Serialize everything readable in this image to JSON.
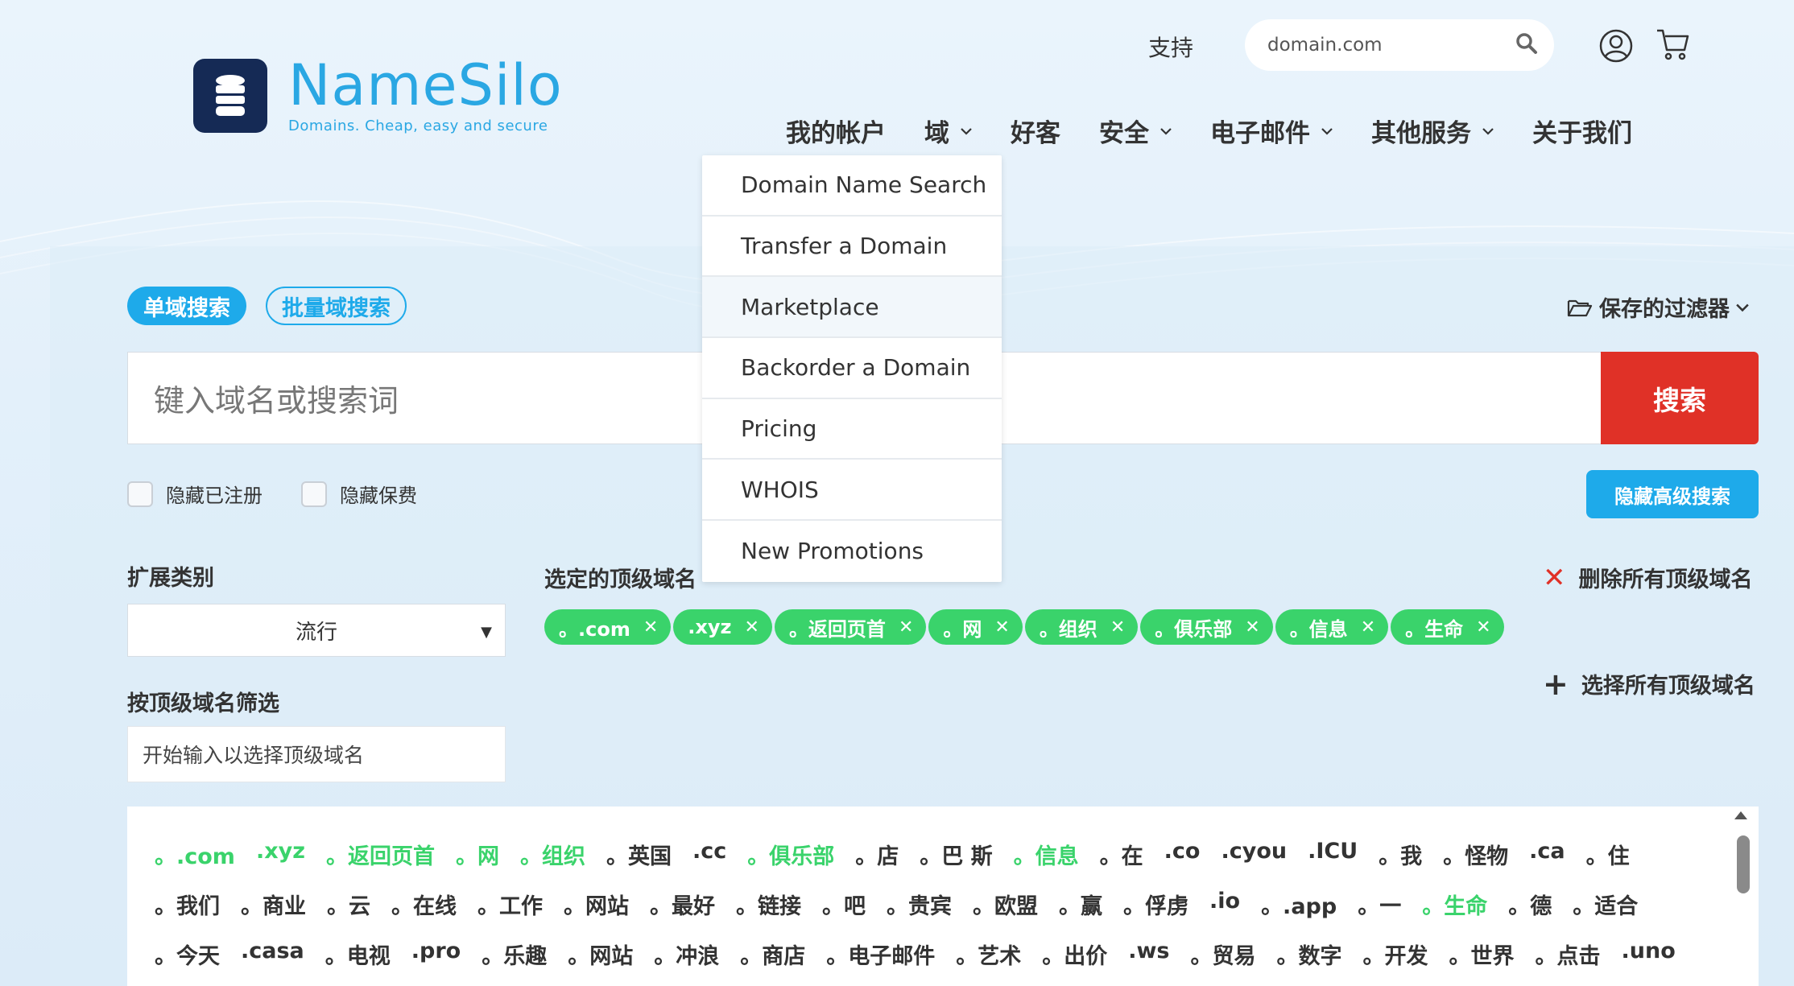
{
  "header": {
    "logo": {
      "name": "NameSilo",
      "tagline": "Domains. Cheap, easy and secure",
      "icon": "database-icon"
    },
    "support_label": "支持",
    "search": {
      "placeholder": "domain.com"
    },
    "nav": [
      {
        "label": "我的帐户",
        "dropdown": false
      },
      {
        "label": "域",
        "dropdown": true
      },
      {
        "label": "好客",
        "dropdown": false
      },
      {
        "label": "安全",
        "dropdown": true
      },
      {
        "label": "电子邮件",
        "dropdown": true
      },
      {
        "label": "其他服务",
        "dropdown": true
      },
      {
        "label": "关于我们",
        "dropdown": false
      }
    ]
  },
  "dropdown": {
    "items": [
      "Domain Name Search",
      "Transfer a Domain",
      "Marketplace",
      "Backorder a Domain",
      "Pricing",
      "WHOIS",
      "New Promotions"
    ],
    "hovered": "Marketplace"
  },
  "search_panel": {
    "tab_single": "单域搜索",
    "tab_bulk": "批量域搜索",
    "saved_filters": "保存的过滤器",
    "input_placeholder": "键入域名或搜索词",
    "search_button": "搜索",
    "hide_registered": "隐藏已注册",
    "hide_premium": "隐藏保费",
    "advanced_button": "隐藏高级搜索",
    "ext_category_label": "扩展类别",
    "ext_category_value": "流行",
    "selected_tlds_label": "选定的顶级域名",
    "remove_all": "删除所有顶级域名",
    "select_all": "选择所有顶级域名",
    "filter_label": "按顶级域名筛选",
    "filter_placeholder": "开始输入以选择顶级域名"
  },
  "selected_tlds": [
    "。.com",
    ".xyz",
    "。返回页首",
    "。网",
    "。组织",
    "。俱乐部",
    "。信息",
    "。生命"
  ],
  "tld_rows": [
    [
      {
        "t": "。.com",
        "g": true
      },
      {
        "t": ".xyz",
        "g": true
      },
      {
        "t": "。返回页首",
        "g": true
      },
      {
        "t": "。网",
        "g": true
      },
      {
        "t": "。组织",
        "g": true
      },
      {
        "t": "。英国",
        "g": false
      },
      {
        "t": ".cc",
        "g": false
      },
      {
        "t": "。俱乐部",
        "g": true
      },
      {
        "t": "。店",
        "g": false
      },
      {
        "t": "。巴 斯",
        "g": false
      },
      {
        "t": "。信息",
        "g": true
      },
      {
        "t": "。在",
        "g": false
      },
      {
        "t": ".co",
        "g": false
      },
      {
        "t": ".cyou",
        "g": false
      },
      {
        "t": ".ICU",
        "g": false
      },
      {
        "t": "。我",
        "g": false
      },
      {
        "t": "。怪物",
        "g": false
      },
      {
        "t": ".ca",
        "g": false
      },
      {
        "t": "。住",
        "g": false
      }
    ],
    [
      {
        "t": "。我们",
        "g": false
      },
      {
        "t": "。商业",
        "g": false
      },
      {
        "t": "。云",
        "g": false
      },
      {
        "t": "。在线",
        "g": false
      },
      {
        "t": "。工作",
        "g": false
      },
      {
        "t": "。网站",
        "g": false
      },
      {
        "t": "。最好",
        "g": false
      },
      {
        "t": "。链接",
        "g": false
      },
      {
        "t": "。吧",
        "g": false
      },
      {
        "t": "。贵宾",
        "g": false
      },
      {
        "t": "。欧盟",
        "g": false
      },
      {
        "t": "。赢",
        "g": false
      },
      {
        "t": "。俘虏",
        "g": false
      },
      {
        "t": ".io",
        "g": false
      },
      {
        "t": "。.app",
        "g": false
      },
      {
        "t": "。一",
        "g": false
      },
      {
        "t": "。生命",
        "g": true
      },
      {
        "t": "。德",
        "g": false
      },
      {
        "t": "。适合",
        "g": false
      }
    ],
    [
      {
        "t": "。今天",
        "g": false
      },
      {
        "t": ".casa",
        "g": false
      },
      {
        "t": "。电视",
        "g": false
      },
      {
        "t": ".pro",
        "g": false
      },
      {
        "t": "。乐趣",
        "g": false
      },
      {
        "t": "。网站",
        "g": false
      },
      {
        "t": "。冲浪",
        "g": false
      },
      {
        "t": "。商店",
        "g": false
      },
      {
        "t": "。电子邮件",
        "g": false
      },
      {
        "t": "。艺术",
        "g": false
      },
      {
        "t": "。出价",
        "g": false
      },
      {
        "t": ".ws",
        "g": false
      },
      {
        "t": "。贸易",
        "g": false
      },
      {
        "t": "。数字",
        "g": false
      },
      {
        "t": "。开发",
        "g": false
      },
      {
        "t": "。世界",
        "g": false
      },
      {
        "t": "。点击",
        "g": false
      },
      {
        "t": ".uno",
        "g": false
      }
    ]
  ],
  "colors": {
    "accent": "#1eaaea",
    "search_button": "#e03127",
    "chip_green": "#3ad36b",
    "logo_dark": "#152a55"
  }
}
